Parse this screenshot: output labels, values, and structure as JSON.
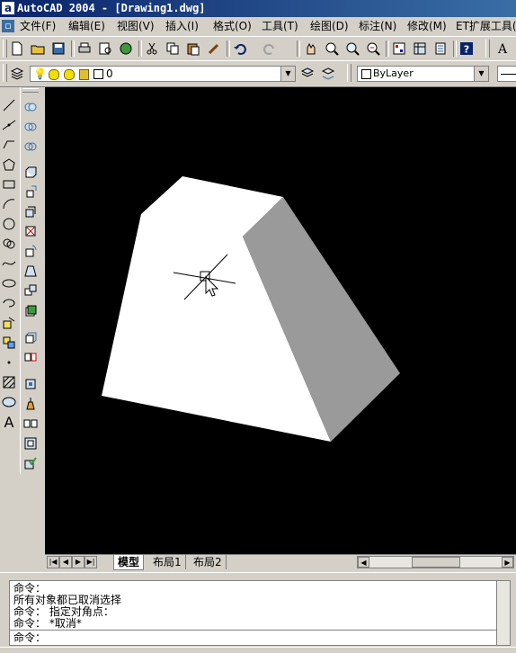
{
  "window": {
    "title": "AutoCAD 2004 - [Drawing1.dwg]"
  },
  "menu": {
    "items": [
      "文件(F)",
      "编辑(E)",
      "视图(V)",
      "插入(I)",
      "格式(O)",
      "工具(T)",
      "绘图(D)",
      "标注(N)",
      "修改(M)",
      "ET扩展工具(X)"
    ]
  },
  "layer_toolbar": {
    "layer_value": "0",
    "linetype_value": "ByLayer"
  },
  "canvas": {
    "background": "#000000",
    "face_light": "#ffffff",
    "face_side": "#9a9a9a"
  },
  "tabs": {
    "model": "模型",
    "layout1": "布局1",
    "layout2": "布局2"
  },
  "command": {
    "lines": [
      "命令：",
      "所有对象都已取消选择",
      "命令： 指定对角点：",
      "命令： *取消*",
      "命令："
    ]
  }
}
